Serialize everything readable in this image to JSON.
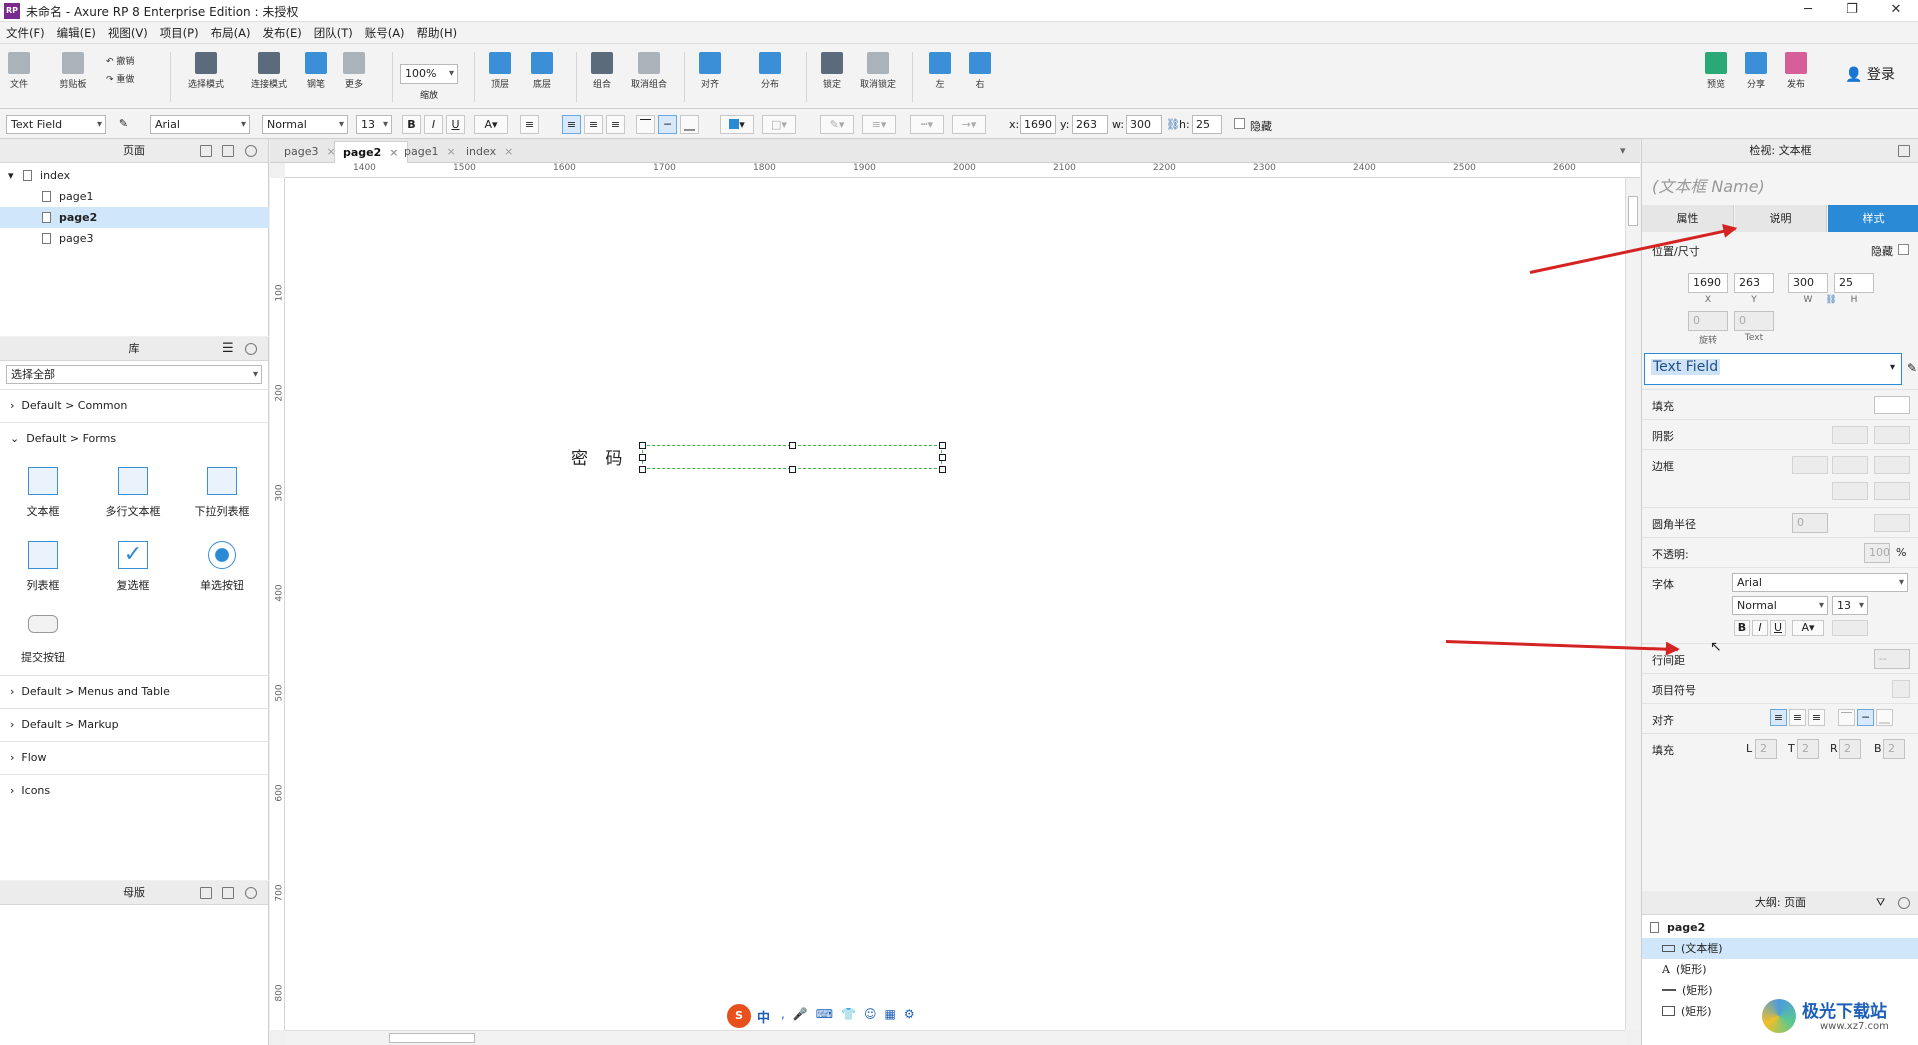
{
  "window": {
    "title": "未命名 - Axure RP 8 Enterprise Edition : 未授权",
    "logo": "RP"
  },
  "menu": [
    "文件(F)",
    "编辑(E)",
    "视图(V)",
    "项目(P)",
    "布局(A)",
    "发布(E)",
    "团队(T)",
    "账号(A)",
    "帮助(H)"
  ],
  "toolbar": {
    "file": "文件",
    "clipboard": "剪贴板",
    "undo": "撤销",
    "redo": "重做",
    "select_mode": "选择模式",
    "connect_mode": "连接模式",
    "pen": "钢笔",
    "more": "更多",
    "zoom_value": "100%",
    "zoom": "缩放",
    "top": "顶层",
    "bottom": "底层",
    "group": "组合",
    "ungroup": "取消组合",
    "align": "对齐",
    "distribute": "分布",
    "lock": "锁定",
    "unlock": "取消锁定",
    "left": "左",
    "right": "右",
    "preview": "预览",
    "share": "分享",
    "publish": "发布",
    "login": "登录"
  },
  "format": {
    "widget_type": "Text Field",
    "font": "Arial",
    "weight": "Normal",
    "size": "13",
    "x_label": "x:",
    "x": "1690",
    "y_label": "y:",
    "y": "263",
    "w_label": "w:",
    "w": "300",
    "h_label": "h:",
    "h": "25",
    "hidden": "隐藏"
  },
  "pages_panel": {
    "title": "页面",
    "items": [
      "index",
      "page1",
      "page2",
      "page3"
    ]
  },
  "library_panel": {
    "title": "库",
    "filter": "选择全部",
    "group_common": "Default > Common",
    "group_forms": "Default > Forms",
    "widgets": [
      "文本框",
      "多行文本框",
      "下拉列表框",
      "列表框",
      "复选框",
      "单选按钮",
      "提交按钮"
    ],
    "groups_after": [
      "Default > Menus and Table",
      "Default > Markup",
      "Flow",
      "Icons"
    ]
  },
  "masters_panel": {
    "title": "母版"
  },
  "tabs": [
    "page3",
    "page2",
    "page1",
    "index"
  ],
  "ruler_h": [
    "1400",
    "1500",
    "1600",
    "1700",
    "1800",
    "1900",
    "2000",
    "2100",
    "2200",
    "2300",
    "2400",
    "2500",
    "2600"
  ],
  "ruler_v": [
    "100",
    "200",
    "300",
    "400",
    "500",
    "600",
    "700",
    "800"
  ],
  "canvas": {
    "label": "密 码"
  },
  "inspector": {
    "title": "检视: 文本框",
    "name_placeholder": "(文本框 Name)",
    "tabs": [
      "属性",
      "说明",
      "样式"
    ],
    "position_size": "位置/尺寸",
    "hidden": "隐藏",
    "x": "1690",
    "y": "263",
    "w": "300",
    "h": "25",
    "cap_x": "X",
    "cap_y": "Y",
    "cap_w": "W",
    "cap_h": "H",
    "rotate": "0",
    "text_rotate": "0",
    "cap_rotate": "旋转",
    "cap_text": "Text",
    "style_name": "Text Field",
    "fill": "填充",
    "shadow": "阴影",
    "border": "边框",
    "radius": "圆角半径",
    "radius_value": "0",
    "opacity": "不透明:",
    "opacity_value": "100",
    "percent": "%",
    "font": "字体",
    "font_value": "Arial",
    "weight_value": "Normal",
    "size_value": "13",
    "line_spacing": "行间距",
    "line_spacing_value": "--",
    "bullet": "项目符号",
    "align": "对齐",
    "padding": "填充",
    "pad_l": "L",
    "pad_l_value": "2",
    "pad_t": "T",
    "pad_t_value": "2",
    "pad_r": "R",
    "pad_r_value": "2",
    "pad_b": "B",
    "pad_b_value": "2"
  },
  "outline": {
    "title": "大纲: 页面",
    "page": "page2",
    "items": [
      "(文本框)",
      "(矩形)",
      "(矩形)",
      "(矩形)"
    ]
  },
  "ime": {
    "label": "中"
  },
  "watermark": {
    "text": "极光下载站",
    "url": "www.xz7.com"
  }
}
